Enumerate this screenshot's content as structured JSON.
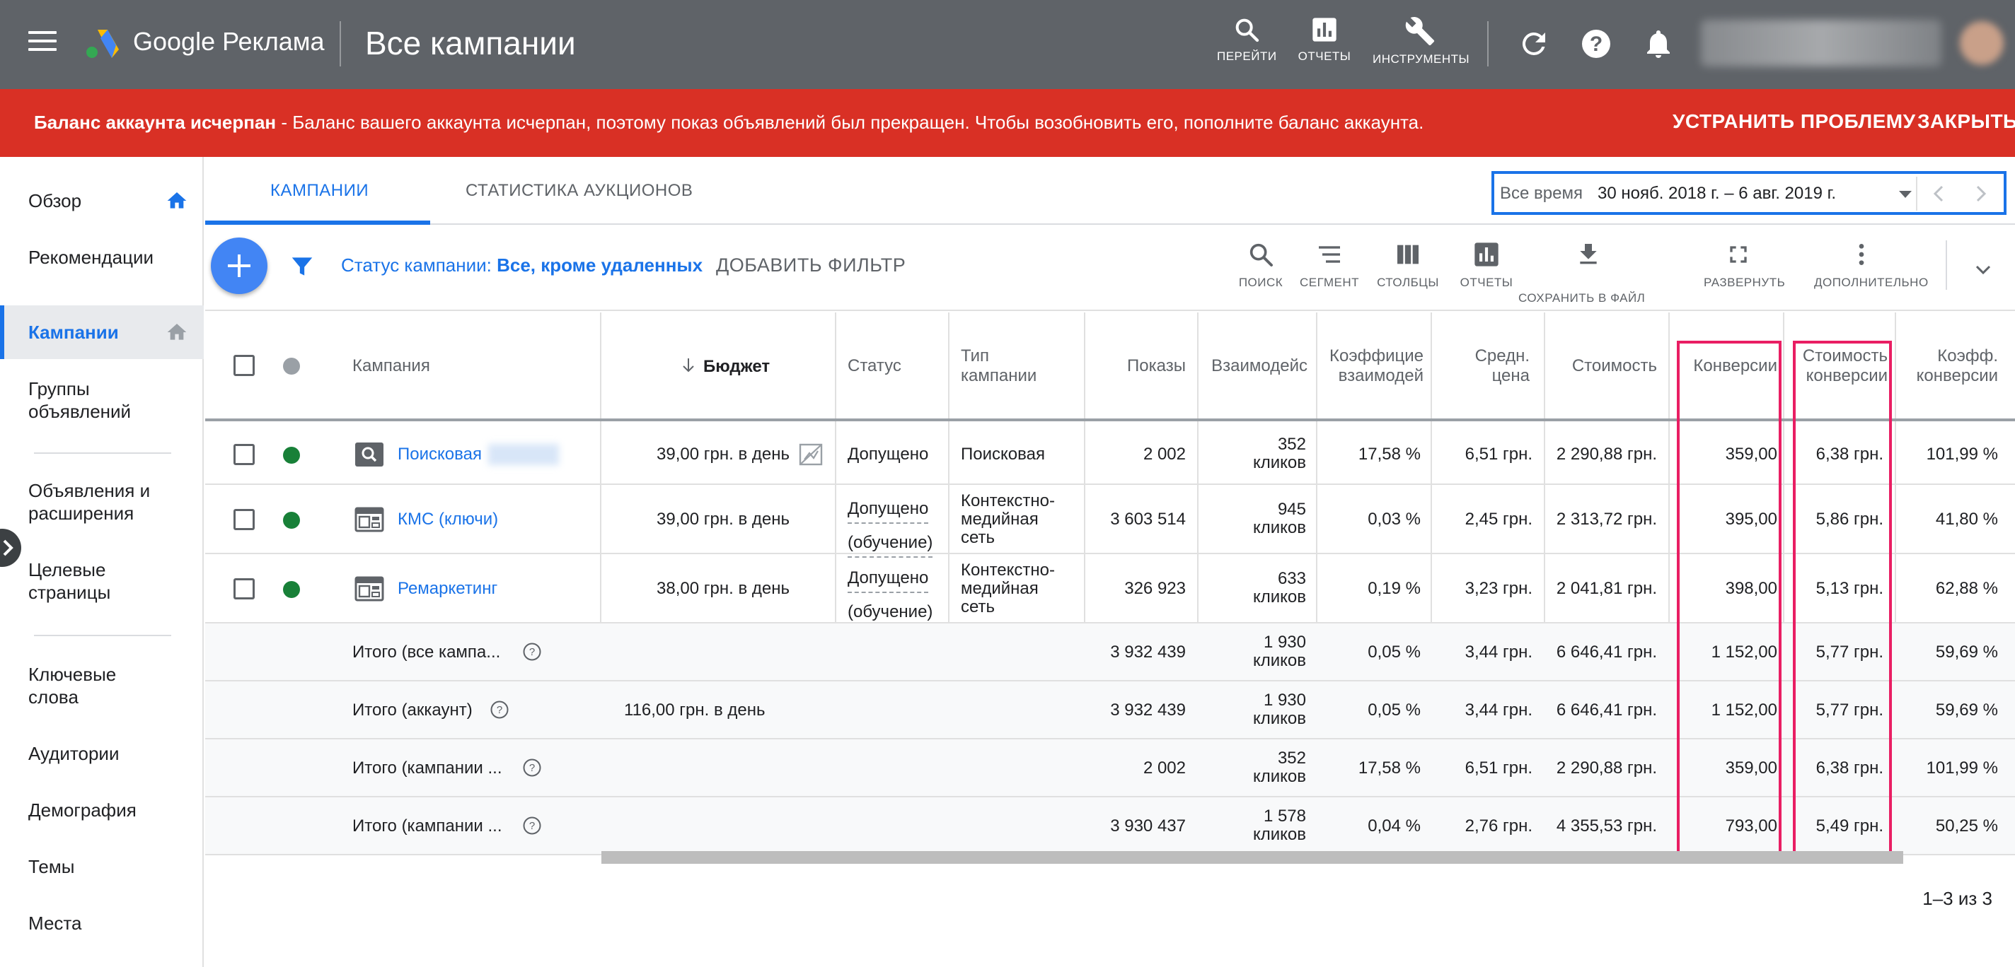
{
  "topbar": {
    "product_name": "Google Реклама",
    "page_title": "Все кампании",
    "buttons": [
      {
        "label": "ПЕРЕЙТИ",
        "icon": "search-icon"
      },
      {
        "label": "ОТЧЕТЫ",
        "icon": "reports-icon"
      },
      {
        "label": "ИНСТРУМЕНТЫ",
        "icon": "wrench-icon"
      }
    ],
    "icons": [
      "refresh-icon",
      "help-icon",
      "notifications-icon"
    ]
  },
  "alert": {
    "title": "Баланс аккаунта исчерпан",
    "message": " - Баланс вашего аккаунта исчерпан, поэтому показ объявлений был прекращен. Чтобы возобновить его, пополните баланс аккаунта.",
    "fix_label": "УСТРАНИТЬ ПРОБЛЕМУ",
    "close_label": "ЗАКРЫТЬ"
  },
  "sidebar": {
    "items": [
      {
        "label": "Обзор"
      },
      {
        "label": "Рекомендации"
      },
      {
        "label": "Кампании"
      },
      {
        "label": "Группы объявлений"
      },
      {
        "label": "Объявления и расширения"
      },
      {
        "label": "Целевые страницы"
      },
      {
        "label": "Ключевые слова"
      },
      {
        "label": "Аудитории"
      },
      {
        "label": "Демография"
      },
      {
        "label": "Темы"
      },
      {
        "label": "Места"
      }
    ],
    "active": "Кампании"
  },
  "tabs": [
    {
      "label": "КАМПАНИИ"
    },
    {
      "label": "СТАТИСТИКА АУКЦИОНОВ"
    }
  ],
  "date_range": {
    "label": "Все время",
    "value": "30 нояб. 2018 г. – 6 авг. 2019 г."
  },
  "filter_bar": {
    "status_label": "Статус кампании: ",
    "status_value": "Все, кроме удаленных",
    "add_filter": "ДОБАВИТЬ ФИЛЬТР"
  },
  "tools": [
    {
      "label": "ПОИСК",
      "icon": "search-icon"
    },
    {
      "label": "СЕГМЕНТ",
      "icon": "segment-icon"
    },
    {
      "label": "СТОЛБЦЫ",
      "icon": "columns-icon"
    },
    {
      "label": "ОТЧЕТЫ",
      "icon": "reports-icon"
    },
    {
      "label": "СОХРАНИТЬ В ФАЙЛ",
      "icon": "download-icon"
    },
    {
      "label": "РАЗВЕРНУТЬ",
      "icon": "fullscreen-icon"
    },
    {
      "label": "ДОПОЛНИТЕЛЬНО",
      "icon": "more-vert-icon"
    }
  ],
  "table": {
    "headers": {
      "campaign": "Кампания",
      "budget": "Бюджет",
      "status": "Статус",
      "type_1": "Тип",
      "type_2": "кампании",
      "impressions": "Показы",
      "interactions": "Взаимодейс",
      "int_rate_1": "Коэффицие",
      "int_rate_2": "взаимодей",
      "avg_cost_1": "Средн.",
      "avg_cost_2": "цена",
      "cost": "Стоимость",
      "conversions": "Конверсии",
      "cost_conv_1": "Стоимость",
      "cost_conv_2": "конверсии",
      "conv_rate_1": "Коэфф.",
      "conv_rate_2": "конверсии"
    },
    "rows": [
      {
        "name": "Поисковая",
        "budget": "39,00 грн. в день",
        "status_1": "Допущено",
        "status_2": "",
        "type_1": "Поисковая",
        "type_2": "",
        "type_3": "",
        "impressions": "2 002",
        "interactions_1": "352",
        "interactions_2": "кликов",
        "int_rate": "17,58 %",
        "avg_cost": "6,51 грн.",
        "cost": "2 290,88 грн.",
        "conversions": "359,00",
        "cost_conv": "6,38 грн.",
        "conv_rate": "101,99 %"
      },
      {
        "name": "КМС (ключи)",
        "budget": "39,00 грн. в день",
        "status_1": "Допущено",
        "status_2": "(обучение)",
        "type_1": "Контекстно-",
        "type_2": "медийная",
        "type_3": "сеть",
        "impressions": "3 603 514",
        "interactions_1": "945",
        "interactions_2": "кликов",
        "int_rate": "0,03 %",
        "avg_cost": "2,45 грн.",
        "cost": "2 313,72 грн.",
        "conversions": "395,00",
        "cost_conv": "5,86 грн.",
        "conv_rate": "41,80 %"
      },
      {
        "name": "Ремаркетинг",
        "budget": "38,00 грн. в день",
        "status_1": "Допущено",
        "status_2": "(обучение)",
        "type_1": "Контекстно-",
        "type_2": "медийная",
        "type_3": "сеть",
        "impressions": "326 923",
        "interactions_1": "633",
        "interactions_2": "кликов",
        "int_rate": "0,19 %",
        "avg_cost": "3,23 грн.",
        "cost": "2 041,81 грн.",
        "conversions": "398,00",
        "cost_conv": "5,13 грн.",
        "conv_rate": "62,88 %"
      }
    ],
    "totals": [
      {
        "name": "Итого (все кампа...",
        "budget": "",
        "impressions": "3 932 439",
        "interactions_1": "1 930",
        "interactions_2": "кликов",
        "int_rate": "0,05 %",
        "avg_cost": "3,44 грн.",
        "cost": "6 646,41 грн.",
        "conversions": "1 152,00",
        "cost_conv": "5,77 грн.",
        "conv_rate": "59,69 %"
      },
      {
        "name": "Итого (аккаунт)",
        "budget": "116,00 грн. в день",
        "impressions": "3 932 439",
        "interactions_1": "1 930",
        "interactions_2": "кликов",
        "int_rate": "0,05 %",
        "avg_cost": "3,44 грн.",
        "cost": "6 646,41 грн.",
        "conversions": "1 152,00",
        "cost_conv": "5,77 грн.",
        "conv_rate": "59,69 %"
      },
      {
        "name": "Итого (кампании ...",
        "budget": "",
        "impressions": "2 002",
        "interactions_1": "352",
        "interactions_2": "кликов",
        "int_rate": "17,58 %",
        "avg_cost": "6,51 грн.",
        "cost": "2 290,88 грн.",
        "conversions": "359,00",
        "cost_conv": "6,38 грн.",
        "conv_rate": "101,99 %"
      },
      {
        "name": "Итого (кампании ...",
        "budget": "",
        "impressions": "3 930 437",
        "interactions_1": "1 578",
        "interactions_2": "кликов",
        "int_rate": "0,04 %",
        "avg_cost": "2,76 грн.",
        "cost": "4 355,53 грн.",
        "conversions": "793,00",
        "cost_conv": "5,49 грн.",
        "conv_rate": "50,25 %"
      }
    ]
  },
  "pagination": "1–3 из 3",
  "colors": {
    "topbar": "#5f6368",
    "alert": "#d93025",
    "accent": "#1a73e8",
    "highlight": "#e91e63",
    "status_enabled": "#188038"
  }
}
